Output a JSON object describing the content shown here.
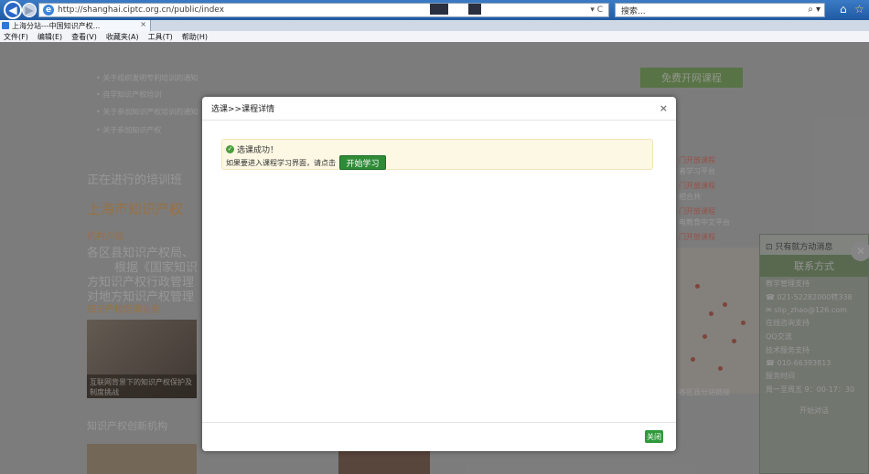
{
  "browser": {
    "url": "http://shanghai.ciptc.org.cn/public/index",
    "search_placeholder": "搜索...",
    "tab_title": "上海分站---中国知识产权...",
    "tab_close": "×",
    "address_tools": "▾ C",
    "icons": {
      "back": "back-arrow-icon",
      "forward": "forward-arrow-icon",
      "home": "home-icon",
      "favorites": "star-icon",
      "search": "search-icon"
    }
  },
  "menu": [
    "文件(F)",
    "编辑(E)",
    "查看(V)",
    "收藏夹(A)",
    "工具(T)",
    "帮助(H)"
  ],
  "background_page": {
    "news_items": [
      "• 关于组织发明专利培训的通知",
      "• 自学知识产权培训",
      "• 关于参加知识产权培训的通知",
      "• 关于参加知识产权"
    ],
    "green_button": "免费开网课程",
    "section_training": "正在进行的培训班",
    "section_shanghai": "上海市知识产权",
    "intro_label": "机构介绍",
    "intro_lines": [
      "各区县知识产权局、",
      "根据《国家知识",
      "方知识产权行政管理",
      "对地方知识产权管理",
      "知识产权培训业务"
    ],
    "photo_caption": "互联网背景下的知识产权保护及制度挑战",
    "section_bottom": "知识产权创新机构",
    "right_list": [
      "门开放课程",
      "者学习平台",
      "门开放课程",
      "相合共",
      "门开放课程",
      "电教育中文平台",
      "门开放课程"
    ],
    "map_caption": "各区县分站链接",
    "side_panel": {
      "head": "⊡ 只有就方动消息",
      "title": "联系方式",
      "lines": [
        "教学管理支持",
        "☎ 021-52282000转338",
        "✉ slip_zhao@126.com",
        "在线咨询支持",
        "QQ交流",
        "技术服务支持",
        "☎ 010-66393813",
        "服务时间",
        "周一至周五 9：00-17：30"
      ],
      "bottom": "开始对话",
      "close": "✕"
    }
  },
  "modal": {
    "title": "选课>>课程详情",
    "close_x": "×",
    "alert": {
      "success_text": "选课成功！",
      "prompt_text": "如果要进入课程学习界面，请点击",
      "start_button": "开始学习"
    },
    "footer_close": "关闭"
  },
  "colors": {
    "accent_green": "#2e8b36",
    "alert_bg": "#fcf8e3",
    "titlebar_blue": "#1f5aa3"
  }
}
